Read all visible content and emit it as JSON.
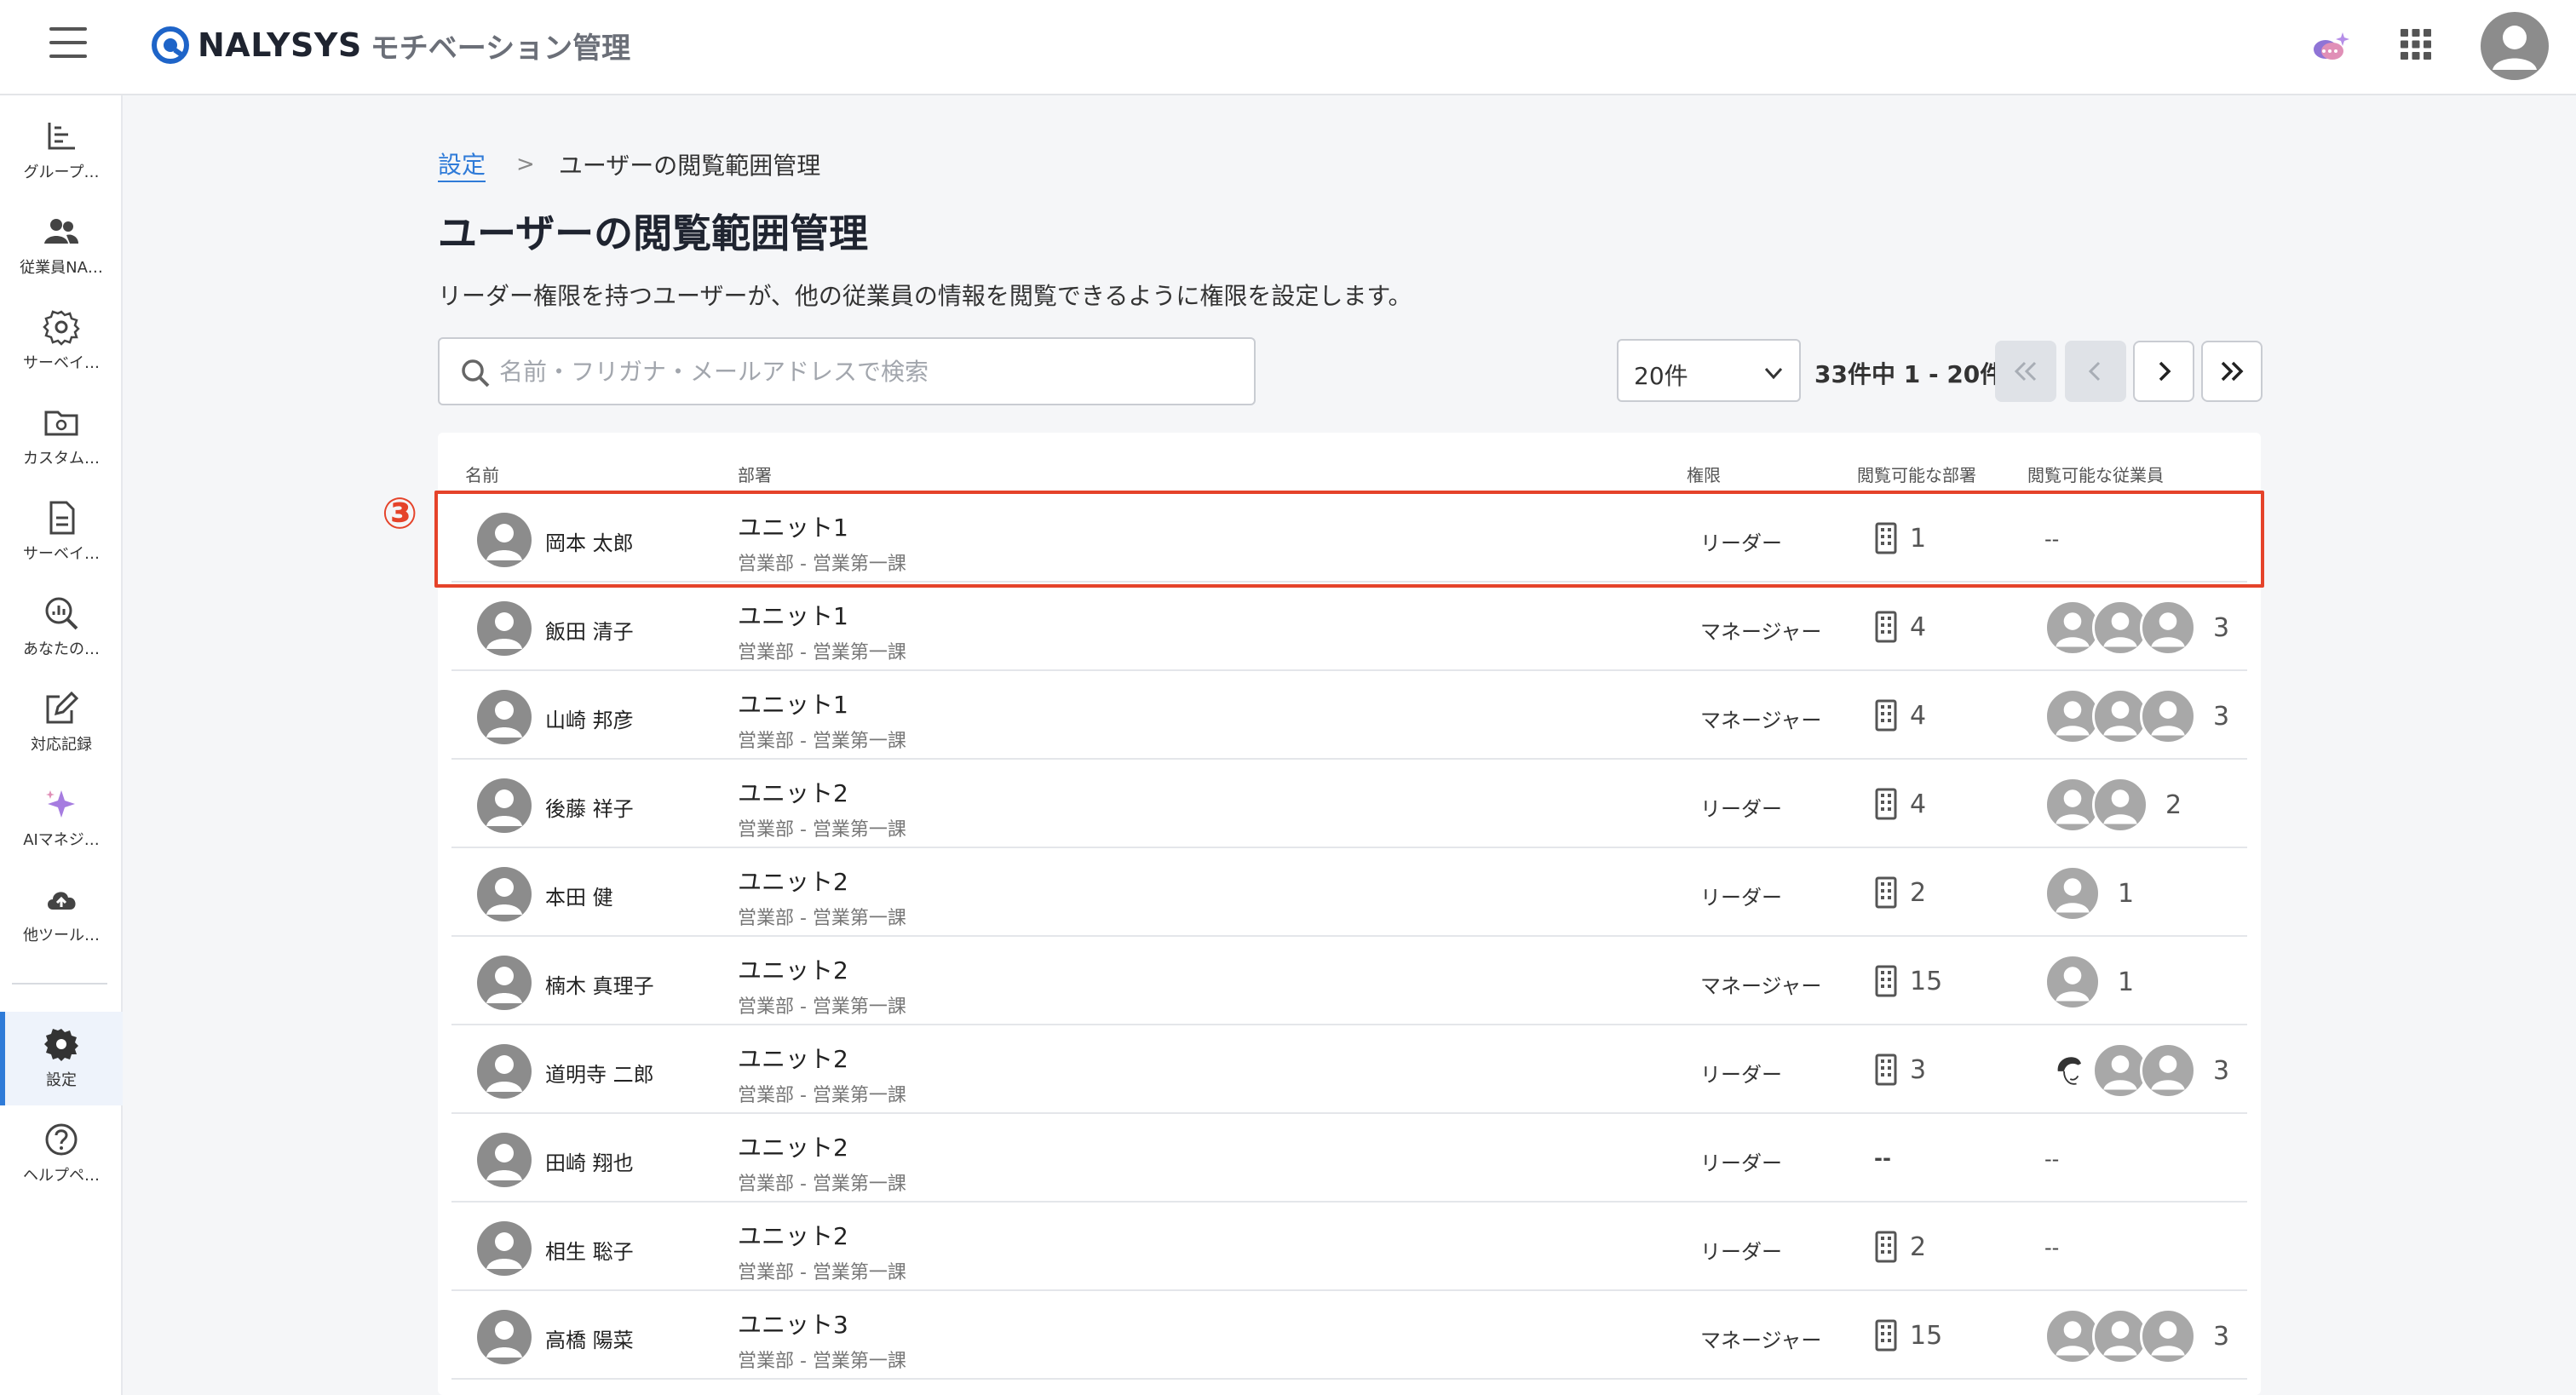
{
  "header": {
    "brand": "NALYSYS",
    "product": "モチベーション管理",
    "icons": [
      "menu-icon",
      "ai-chat-icon",
      "apps-grid-icon",
      "user-avatar"
    ]
  },
  "sidebar": {
    "items": [
      {
        "label": "グループ…",
        "icon": "chart-icon"
      },
      {
        "label": "従業員NA…",
        "icon": "people-icon"
      },
      {
        "label": "サーベイ…",
        "icon": "gear-outline-icon"
      },
      {
        "label": "カスタム…",
        "icon": "folder-gear-icon"
      },
      {
        "label": "サーベイ…",
        "icon": "document-icon"
      },
      {
        "label": "あなたの…",
        "icon": "analytics-search-icon"
      },
      {
        "label": "対応記録",
        "icon": "edit-icon"
      },
      {
        "label": "AIマネジ…",
        "icon": "sparkle-icon"
      },
      {
        "label": "他ツール…",
        "icon": "cloud-upload-icon"
      },
      {
        "label": "設定",
        "icon": "gear-icon",
        "active": true
      },
      {
        "label": "ヘルプペ…",
        "icon": "help-icon"
      }
    ]
  },
  "breadcrumb": {
    "parent": "設定",
    "separator": ">",
    "current": "ユーザーの閲覧範囲管理"
  },
  "page": {
    "title": "ユーザーの閲覧範囲管理",
    "description": "リーダー権限を持つユーザーが、他の従業員の情報を閲覧できるように権限を設定します。"
  },
  "search": {
    "placeholder": "名前・フリガナ・メールアドレスで検索",
    "value": ""
  },
  "pagination": {
    "per_page": "20件",
    "info": "33件中 1 - 20件"
  },
  "table": {
    "headers": {
      "name": "名前",
      "department": "部署",
      "role": "権限",
      "viewable_departments": "閲覧可能な部署",
      "viewable_employees": "閲覧可能な従業員"
    },
    "rows": [
      {
        "name": "岡本 太郎",
        "unit": "ユニット1",
        "path": "営業部 - 営業第一課",
        "role": "リーダー",
        "dept_count": "1",
        "emp_count": "--",
        "emp_avatars": 0
      },
      {
        "name": "飯田 清子",
        "unit": "ユニット1",
        "path": "営業部 - 営業第一課",
        "role": "マネージャー",
        "dept_count": "4",
        "emp_count": "3",
        "emp_avatars": 3
      },
      {
        "name": "山崎 邦彦",
        "unit": "ユニット1",
        "path": "営業部 - 営業第一課",
        "role": "マネージャー",
        "dept_count": "4",
        "emp_count": "3",
        "emp_avatars": 3
      },
      {
        "name": "後藤 祥子",
        "unit": "ユニット2",
        "path": "営業部 - 営業第一課",
        "role": "リーダー",
        "dept_count": "4",
        "emp_count": "2",
        "emp_avatars": 2
      },
      {
        "name": "本田 健",
        "unit": "ユニット2",
        "path": "営業部 - 営業第一課",
        "role": "リーダー",
        "dept_count": "2",
        "emp_count": "1",
        "emp_avatars": 1
      },
      {
        "name": "楠木 真理子",
        "unit": "ユニット2",
        "path": "営業部 - 営業第一課",
        "role": "マネージャー",
        "dept_count": "15",
        "emp_count": "1",
        "emp_avatars": 1
      },
      {
        "name": "道明寺 二郎",
        "unit": "ユニット2",
        "path": "営業部 - 営業第一課",
        "role": "リーダー",
        "dept_count": "3",
        "emp_count": "3",
        "emp_avatars": 3,
        "first_avatar_photo": true
      },
      {
        "name": "田崎 翔也",
        "unit": "ユニット2",
        "path": "営業部 - 営業第一課",
        "role": "リーダー",
        "dept_count": "--",
        "emp_count": "--",
        "emp_avatars": 0
      },
      {
        "name": "相生 聡子",
        "unit": "ユニット2",
        "path": "営業部 - 営業第一課",
        "role": "リーダー",
        "dept_count": "2",
        "emp_count": "--",
        "emp_avatars": 0
      },
      {
        "name": "高橋 陽菜",
        "unit": "ユニット3",
        "path": "営業部 - 営業第一課",
        "role": "マネージャー",
        "dept_count": "15",
        "emp_count": "3",
        "emp_avatars": 3
      }
    ]
  },
  "annotation": {
    "step_label": "③",
    "highlight_color": "#e5432a"
  },
  "colors": {
    "accent": "#2f7bd8",
    "highlight": "#e5432a",
    "avatar_gray": "#8c8c8c"
  }
}
